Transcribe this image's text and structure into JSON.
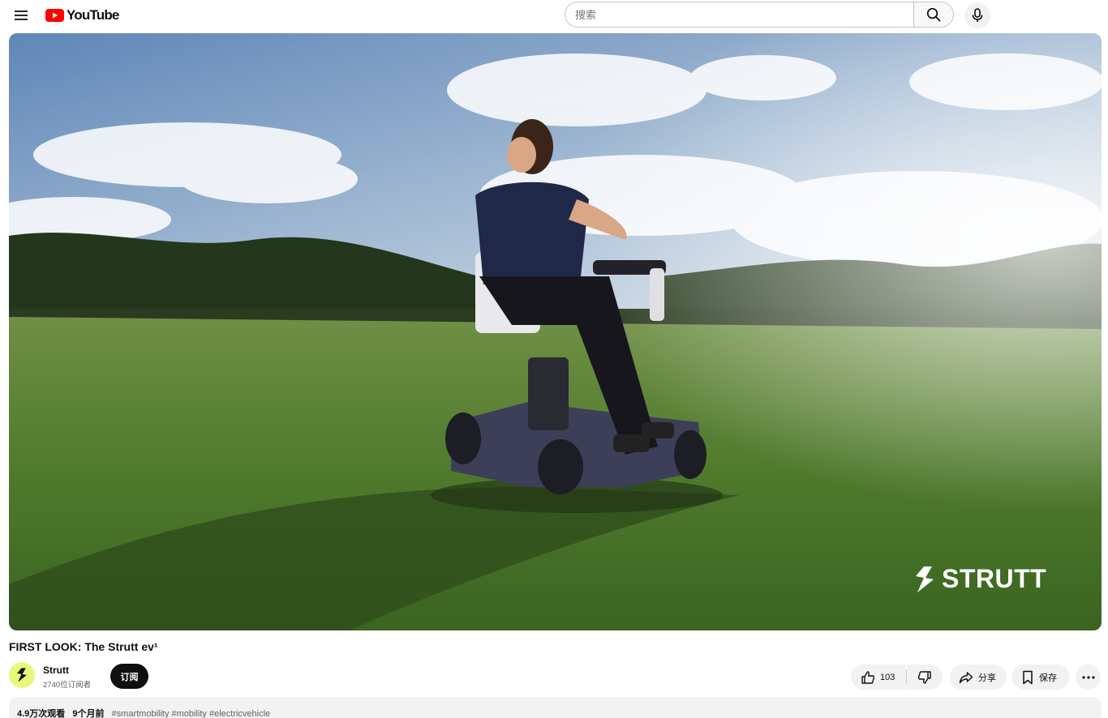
{
  "masthead": {
    "logo_text": "YouTube",
    "search_placeholder": "搜索",
    "menu_icon": "hamburger-menu-icon",
    "search_icon": "search-icon",
    "mic_icon": "microphone-icon"
  },
  "player": {
    "watermark_text": "STRUTT",
    "watermark_icon": "strutt-logo-icon"
  },
  "video": {
    "title": "FIRST LOOK: The Strutt ev¹"
  },
  "owner": {
    "channel_name": "Strutt",
    "subscribers": "2740位订阅者",
    "subscribe_label": "订阅",
    "avatar_color": "#e8f97a"
  },
  "actions": {
    "like_count": "103",
    "share_label": "分享",
    "save_label": "保存"
  },
  "description": {
    "views": "4.9万次观看",
    "date": "9个月前",
    "tags": "#smartmobility #mobility #electricvehicle"
  },
  "colors": {
    "brand_red": "#ff0000",
    "subscribe_bg": "#0f0f0f",
    "pill_bg": "#f2f2f2"
  }
}
